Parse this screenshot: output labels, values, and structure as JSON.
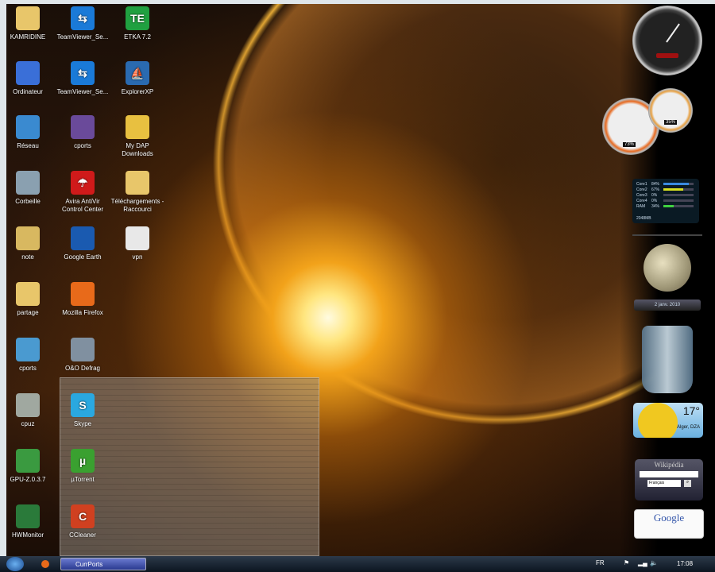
{
  "icons": [
    [
      "KAMRIDINE",
      "Ordinateur",
      "Réseau",
      "Corbeille",
      "note",
      "partage",
      "cports",
      "cpuz",
      "GPU-Z.0.3.7",
      "HWMonitor"
    ],
    [
      "TeamViewer_Se...",
      "TeamViewer_Se...",
      "cports",
      "Avira AntiVir Control Center",
      "Google Earth",
      "Mozilla Firefox",
      "O&O Defrag",
      "Skype",
      "µTorrent",
      "CCleaner"
    ],
    [
      "ETKA 7.2",
      "ExplorerXP",
      "My DAP Downloads",
      "Téléchargements - Raccourci",
      "vpn"
    ]
  ],
  "icon_colors": [
    [
      "#e8c66a",
      "#3a6fd8",
      "#3a8ad0",
      "#8aa0b0",
      "#d8b860",
      "#e8c66a",
      "#4a9ad0",
      "#a0a8a0",
      "#3a9a40",
      "#2a7a3a"
    ],
    [
      "#1a7ad8",
      "#1a7ad8",
      "#6a4a9a",
      "#d01a1a",
      "#1a5ab0",
      "#e86a1a",
      "#8090a0",
      "#2aa8e0",
      "#3aa030",
      "#d04020"
    ],
    [
      "#20a040",
      "#2a6ab0",
      "#e8c040",
      "#e8c66a",
      "#e8e8e8"
    ]
  ],
  "icon_glyphs": [
    [
      "",
      "",
      "",
      "",
      "",
      "",
      "",
      "",
      "",
      ""
    ],
    [
      "⇆",
      "⇆",
      "",
      "☂",
      "",
      "",
      "",
      "S",
      "µ",
      "C"
    ],
    [
      "TE",
      "⛵",
      "",
      "",
      ""
    ]
  ],
  "gauges": {
    "big": "73%",
    "small": "35%"
  },
  "cpu_meter": {
    "rows": [
      {
        "label": "Core1",
        "value": "84%",
        "pct": 84,
        "color": "#3a8ae0"
      },
      {
        "label": "Core2",
        "value": "67%",
        "pct": 67,
        "color": "#d8e020"
      },
      {
        "label": "Core3",
        "value": "0%",
        "pct": 0,
        "color": "#888"
      },
      {
        "label": "Core4",
        "value": "0%",
        "pct": 0,
        "color": "#888"
      },
      {
        "label": "RAM",
        "value": "34%",
        "pct": 34,
        "color": "#40d040"
      }
    ],
    "memory": "2048MB"
  },
  "moon": {
    "date": "2 janv. 2010"
  },
  "weather": {
    "temp": "17°",
    "location": "Alger, DZA"
  },
  "wikipedia": {
    "title": "Wikipédia",
    "language": "Français"
  },
  "google": {
    "title": "Google"
  },
  "taskbar": {
    "window": "CurrPorts",
    "lang": "FR",
    "time": "17:08"
  }
}
